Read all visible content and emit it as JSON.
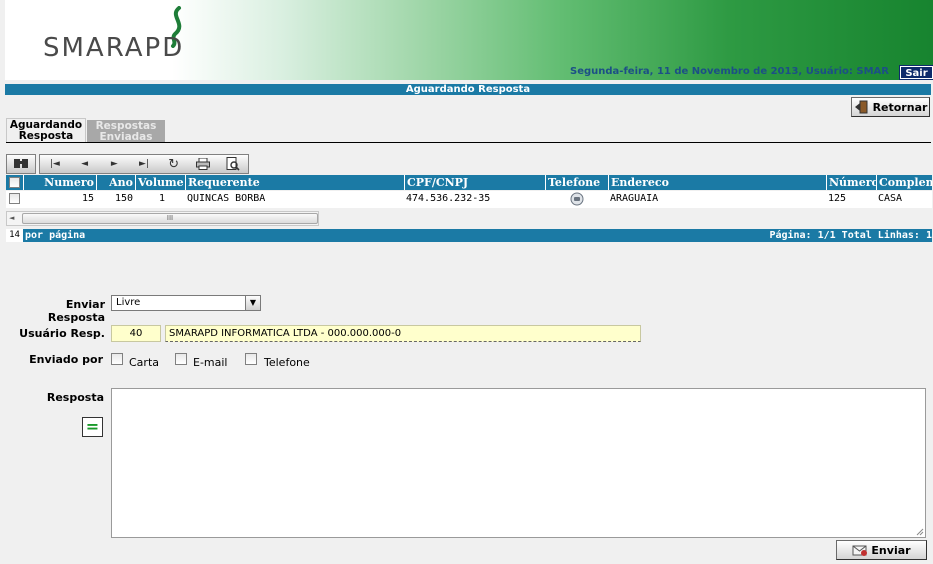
{
  "header": {
    "logo_text": "SMARAPD",
    "dateline": "Segunda-feira, 11 de Novembro de 2013, Usuário: SMAR",
    "logout_label": "Sair"
  },
  "page_title": "Aguardando Resposta",
  "actions": {
    "back_label": "Retornar",
    "send_label": "Enviar"
  },
  "tabs": [
    {
      "line1": "Aguardando",
      "line2": "Resposta",
      "active": true
    },
    {
      "line1": "Respostas",
      "line2": "Enviadas",
      "active": false
    }
  ],
  "grid": {
    "columns": [
      "Numero",
      "Ano",
      "Volume",
      "Requerente",
      "CPF/CNPJ",
      "Telefone",
      "Endereco",
      "Número",
      "Compleme"
    ],
    "rows": [
      {
        "numero": "15",
        "ano": "150",
        "volume": "1",
        "requerente": "QUINCAS BORBA",
        "cpf": "474.536.232-35",
        "telefone_icon": "phone-icon",
        "endereco": "ARAGUAIA",
        "numero_end": "125",
        "complemento": "CASA"
      }
    ],
    "scroll_thumb": "III",
    "per_page_value": "14",
    "per_page_label": "por página",
    "pagination": "Página: 1/1 Total Linhas: 1"
  },
  "form": {
    "enviar_resposta_label": "Enviar Resposta",
    "enviar_resposta_value": "Livre",
    "usuario_label": "Usuário Resp.",
    "usuario_code": "40",
    "usuario_name": "SMARAPD INFORMATICA LTDA - 000.000.000-0",
    "enviado_por_label": "Enviado por",
    "options": [
      "Carta",
      "E-mail",
      "Telefone"
    ],
    "resposta_label": "Resposta",
    "eq_button": "="
  },
  "colors": {
    "header_blue": "#1b7aa5",
    "brand_green": "#17842f",
    "field_yellow": "#ffffcc"
  }
}
